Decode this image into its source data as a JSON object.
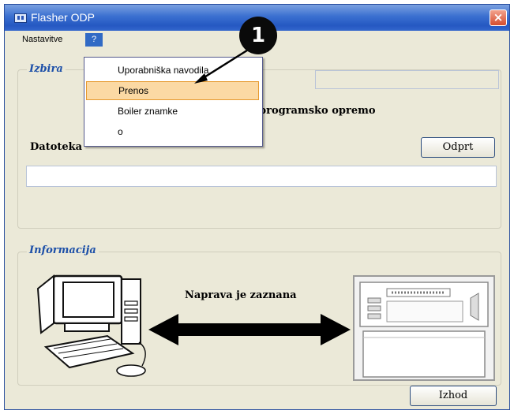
{
  "window": {
    "title": "Flasher ODP",
    "close_glyph": "×"
  },
  "menubar": {
    "items": [
      {
        "label": "Nastavitve"
      },
      {
        "label": "?"
      }
    ]
  },
  "dropdown": {
    "items": [
      {
        "label": "Uporabniška navodila",
        "highlighted": false
      },
      {
        "label": "Prenos",
        "highlighted": true
      },
      {
        "label": "Boiler znamke",
        "highlighted": false
      },
      {
        "label": "o",
        "highlighted": false
      }
    ]
  },
  "izbira": {
    "legend": "Izbira",
    "text_fragment": "programsko opremo",
    "file_label": "Datoteka",
    "open_button": "Odprt",
    "file_value": ""
  },
  "informacija": {
    "legend": "Informacija",
    "status": "Naprava je zaznana"
  },
  "footer": {
    "exit_button": "Izhod"
  },
  "callout": {
    "number": "1"
  },
  "colors": {
    "titlebar": "#2558c2",
    "menu_selected": "#316ac5",
    "highlight": "#fbd9a4",
    "legend_text": "#1c4fa8"
  }
}
